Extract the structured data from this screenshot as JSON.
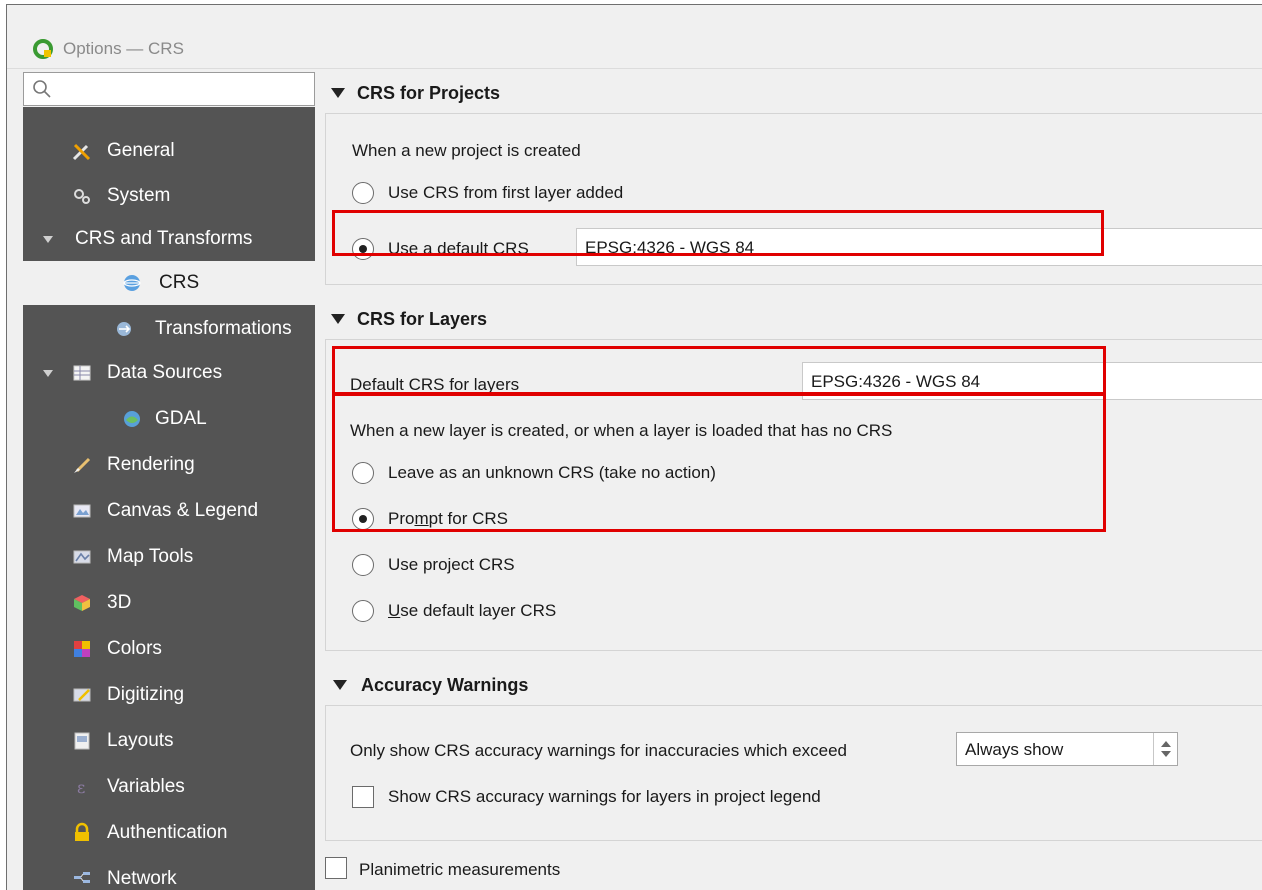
{
  "window": {
    "title": "Options — CRS"
  },
  "search": {
    "placeholder": ""
  },
  "sidebar": {
    "items": [
      {
        "label": "General",
        "icon": "tools-icon"
      },
      {
        "label": "System",
        "icon": "system-icon"
      },
      {
        "label": "CRS and Transforms",
        "icon": ""
      },
      {
        "label": "CRS",
        "icon": "globe-icon"
      },
      {
        "label": "Transformations",
        "icon": "transform-icon"
      },
      {
        "label": "Data Sources",
        "icon": "table-icon"
      },
      {
        "label": "GDAL",
        "icon": "gdal-icon"
      },
      {
        "label": "Rendering",
        "icon": "brush-icon"
      },
      {
        "label": "Canvas & Legend",
        "icon": "canvas-icon"
      },
      {
        "label": "Map Tools",
        "icon": "map-tools-icon"
      },
      {
        "label": "3D",
        "icon": "cube-icon"
      },
      {
        "label": "Colors",
        "icon": "palette-icon"
      },
      {
        "label": "Digitizing",
        "icon": "digitizing-icon"
      },
      {
        "label": "Layouts",
        "icon": "layouts-icon"
      },
      {
        "label": "Variables",
        "icon": "variables-icon"
      },
      {
        "label": "Authentication",
        "icon": "lock-icon"
      },
      {
        "label": "Network",
        "icon": "network-icon"
      }
    ]
  },
  "crs_projects": {
    "header": "CRS for Projects",
    "when_new": "When a new project is created",
    "opt_first_layer": "Use CRS from first layer added",
    "opt_default_prefix": "",
    "opt_default_u": "U",
    "opt_default_rest": "se a default CRS",
    "default_crs_value": "EPSG:4326 - WGS 84"
  },
  "crs_layers": {
    "header": "CRS for Layers",
    "default_label": "Default CRS for layers",
    "default_value": "EPSG:4326 - WGS 84",
    "when_new": "When a new layer is created, or when a layer is loaded that has no CRS",
    "opt_unknown": "Leave as an unknown CRS (take no action)",
    "opt_prompt_a": "Pro",
    "opt_prompt_u": "m",
    "opt_prompt_b": "pt for CRS",
    "opt_project": "Use project CRS",
    "opt_default_u": "U",
    "opt_default_rest": "se default layer CRS"
  },
  "accuracy": {
    "header": "Accuracy Warnings",
    "exceed_label": "Only show CRS accuracy warnings for inaccuracies which exceed",
    "exceed_value": "Always show",
    "show_legend_label": "Show CRS accuracy warnings for layers in project legend"
  },
  "planimetric": {
    "label": "Planimetric measurements"
  },
  "colors": {
    "highlight": "#e00000",
    "sidebar_bg": "#545454"
  }
}
